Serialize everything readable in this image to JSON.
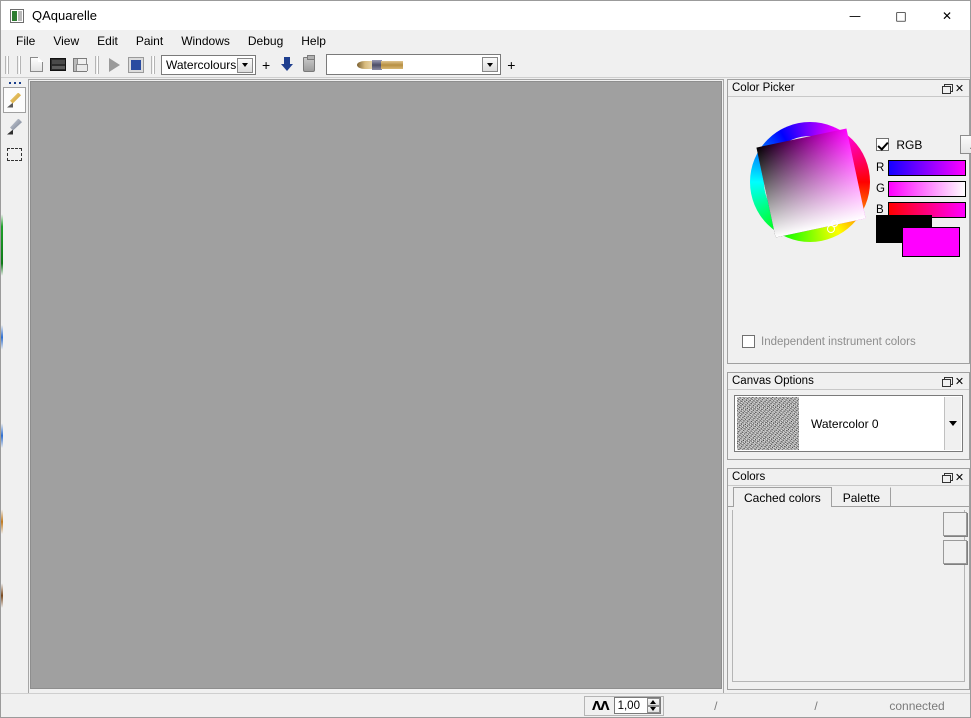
{
  "window": {
    "title": "QAquarelle",
    "icon": "app-icon",
    "minimize": "—",
    "maximize": "☐",
    "close": "✕"
  },
  "menubar": {
    "items": [
      {
        "label": "File"
      },
      {
        "label": "View"
      },
      {
        "label": "Edit"
      },
      {
        "label": "Paint"
      },
      {
        "label": "Windows"
      },
      {
        "label": "Debug"
      },
      {
        "label": "Help"
      }
    ]
  },
  "toolbar": {
    "new_icon": "new-document-icon",
    "open_icon": "open-folder-icon",
    "save_icon": "save-floppy-icon",
    "play_icon": "play-icon",
    "stop_icon": "stop-square-icon",
    "preset_combo": {
      "value": "Watercolours",
      "arrow": "chevron-down-icon"
    },
    "add_preset_label": "+",
    "import_icon": "download-arrow-icon",
    "delete_icon": "trash-icon",
    "brush_combo": {
      "value": "",
      "preview": "brush-preview-image",
      "arrow": "chevron-down-icon"
    },
    "add_brush_label": "+"
  },
  "tools": {
    "items": [
      {
        "name": "brush-tool",
        "icon": "brush-icon",
        "selected": true
      },
      {
        "name": "color-picker-tool",
        "icon": "eyedropper-icon",
        "selected": false
      },
      {
        "name": "selection-tool",
        "icon": "marquee-select-icon",
        "selected": false
      }
    ]
  },
  "canvas": {
    "background_color": "#a0a0a0"
  },
  "panels": {
    "color_picker": {
      "title": "Color Picker",
      "float_icon": "float-panel-icon",
      "close_icon": "close-panel-icon",
      "rgb_checkbox": {
        "label": "RGB",
        "checked": true
      },
      "more_button": "...",
      "channels": [
        {
          "label": "R",
          "gradient_from": "#1400ff",
          "gradient_to": "#ff00ff"
        },
        {
          "label": "G",
          "gradient_from": "#ff00ff",
          "gradient_to": "#ffffff"
        },
        {
          "label": "B",
          "gradient_from": "#ff0000",
          "gradient_to": "#ff00ff"
        }
      ],
      "swatch_back": "#000000",
      "swatch_front": "#ff00ff",
      "independent_colors": {
        "label": "Independent instrument colors",
        "checked": false
      }
    },
    "canvas_options": {
      "title": "Canvas Options",
      "float_icon": "float-panel-icon",
      "close_icon": "close-panel-icon",
      "selected_canvas": "Watercolor 0",
      "arrow": "chevron-down-icon"
    },
    "colors": {
      "title": "Colors",
      "float_icon": "float-panel-icon",
      "close_icon": "close-panel-icon",
      "tabs": [
        {
          "label": "Cached colors",
          "active": true
        },
        {
          "label": "Palette",
          "active": false
        }
      ],
      "action_buttons": [
        {
          "name": "add-color-button"
        },
        {
          "name": "remove-color-button"
        }
      ]
    }
  },
  "statusbar": {
    "zoom_icon": "zoom-level-icon",
    "zoom_glyph": "ΛΛ",
    "zoom_value": "1,00",
    "slot1": "/",
    "slot2": "/",
    "connection": "connected"
  }
}
